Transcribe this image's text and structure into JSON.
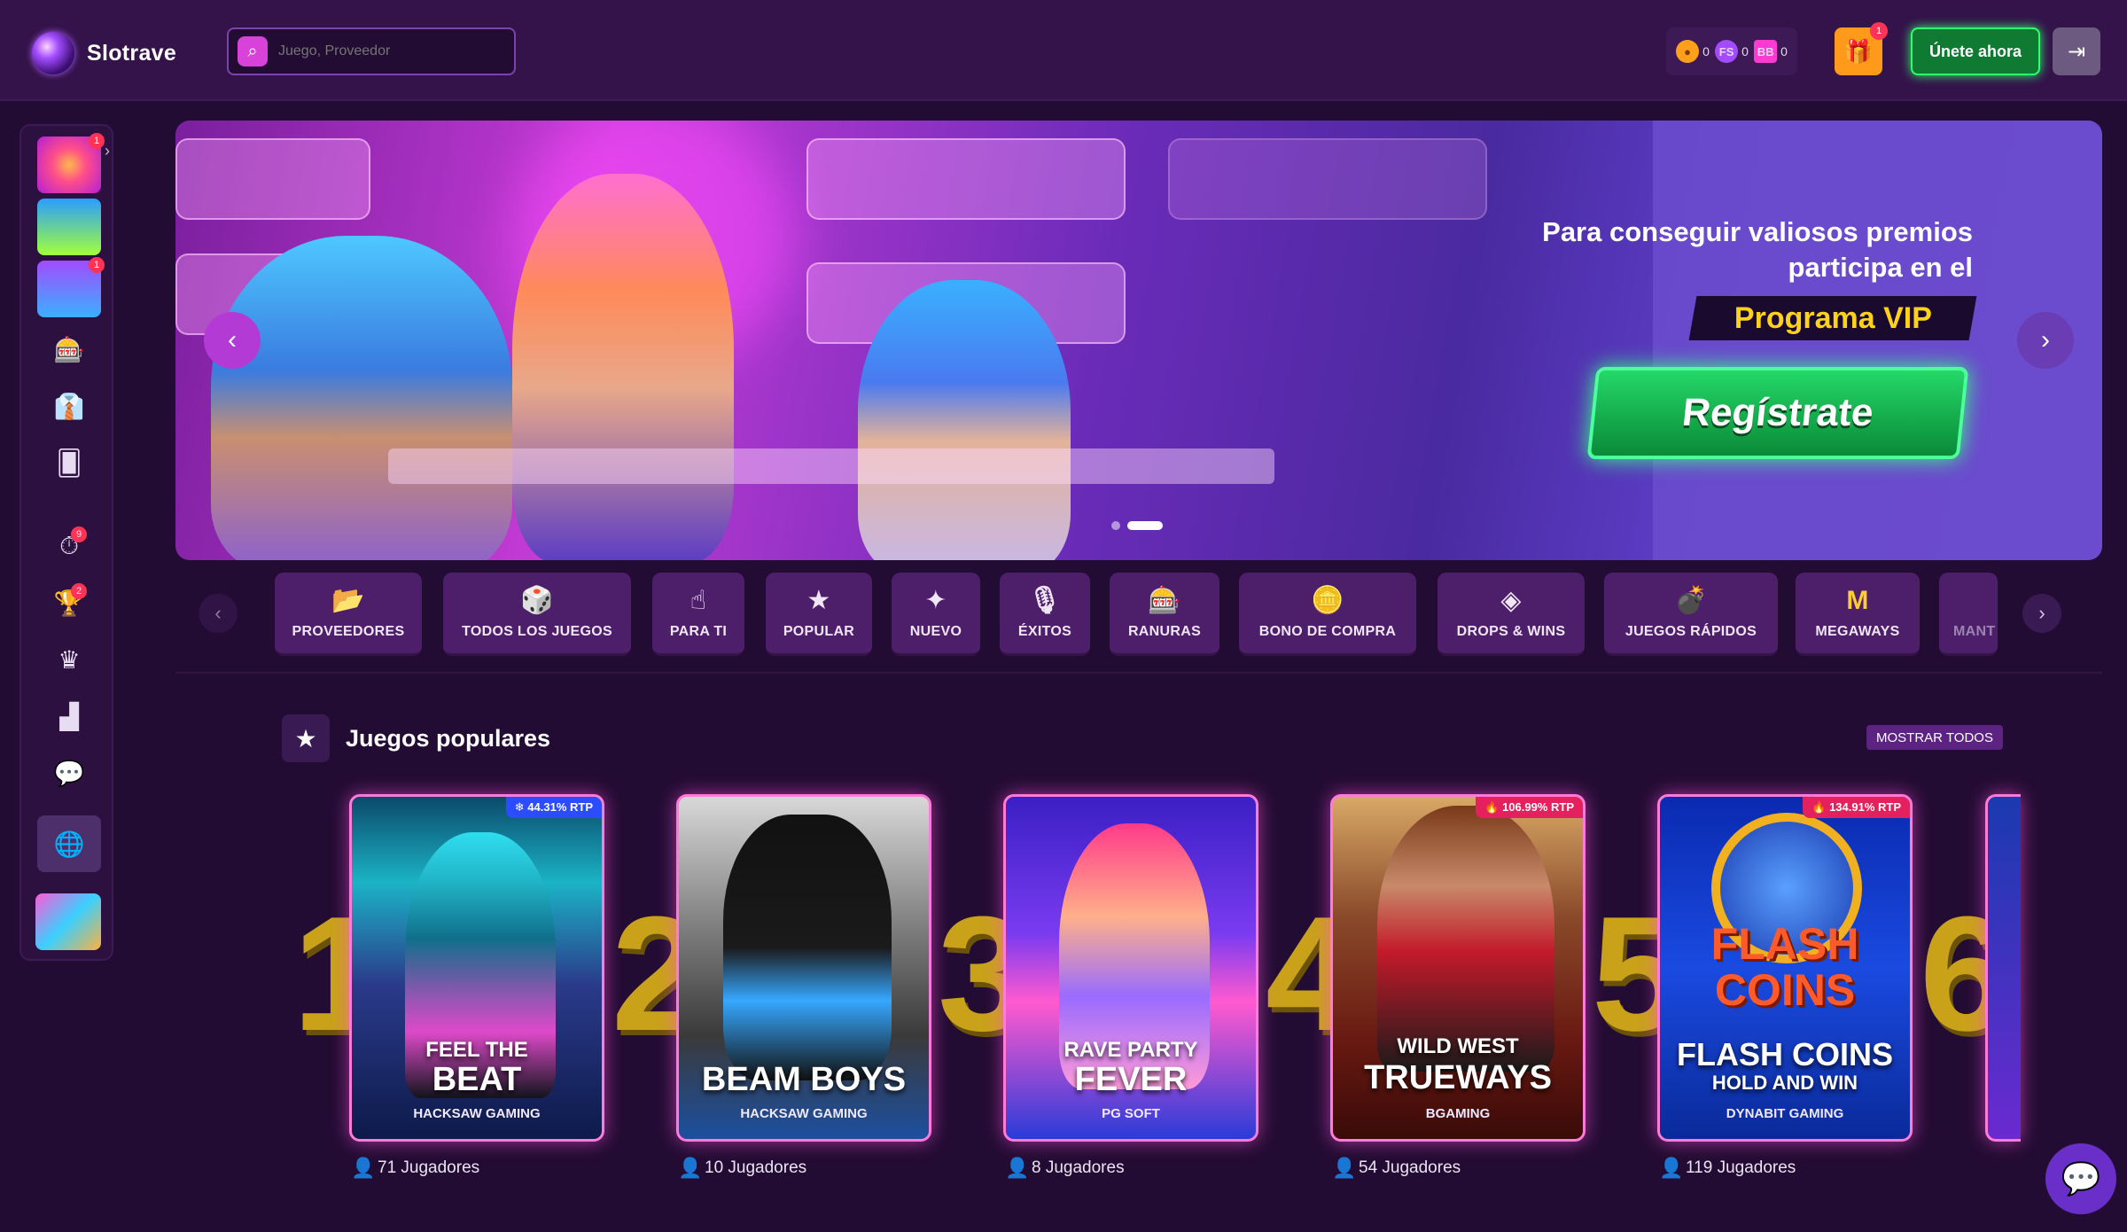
{
  "header": {
    "logo_text": "Slotrave",
    "search_placeholder": "Juego, Proveedor",
    "balances": [
      {
        "icon": "gold-coin-icon",
        "value": "0"
      },
      {
        "icon": "fs-coin-icon",
        "value": "0"
      },
      {
        "icon": "bb-coin-icon",
        "value": "0"
      }
    ],
    "gift_badge": "1",
    "join_label": "Únete ahora"
  },
  "sidebar": {
    "game_badges": [
      "1",
      "",
      "1"
    ],
    "icon_badges": {
      "timer": "9",
      "trophy": "2"
    }
  },
  "banner": {
    "text": "Para conseguir valiosos premios participa en el",
    "vip": "Programa VIP",
    "cta": "Regístrate",
    "slides": 2,
    "active_slide": 2
  },
  "categories": [
    {
      "label": "PROVEEDORES",
      "icon": "folder-icon"
    },
    {
      "label": "TODOS LOS JUEGOS",
      "icon": "dice-icon"
    },
    {
      "label": "PARA TI",
      "icon": "pointer-icon"
    },
    {
      "label": "POPULAR",
      "icon": "star-icon"
    },
    {
      "label": "NUEVO",
      "icon": "sparkle-icon"
    },
    {
      "label": "ÉXITOS",
      "icon": "microphone-icon"
    },
    {
      "label": "RANURAS",
      "icon": "slot-machine-icon"
    },
    {
      "label": "BONO DE COMPRA",
      "icon": "coin-icon"
    },
    {
      "label": "DROPS & WINS",
      "icon": "drops-wins-icon"
    },
    {
      "label": "JUEGOS RÁPIDOS",
      "icon": "bomb-icon"
    },
    {
      "label": "MEGAWAYS",
      "icon": "megaways-icon"
    },
    {
      "label": "MANT",
      "icon": "cut-off-icon"
    }
  ],
  "popular": {
    "title": "Juegos populares",
    "show_all": "MOSTRAR TODOS",
    "games": [
      {
        "rank": "1",
        "title_small": "FEEL THE",
        "title_big": "BEAT",
        "provider": "HACKSAW GAMING",
        "rtp": "❄ 44.31% RTP",
        "rtp_color": "#2c4cff",
        "players": "71 Jugadores"
      },
      {
        "rank": "2",
        "title_small": "",
        "title_big": "BEAM BOYS",
        "provider": "HACKSAW GAMING",
        "rtp": "",
        "rtp_color": "",
        "players": "10 Jugadores"
      },
      {
        "rank": "3",
        "title_small": "RAVE PARTY",
        "title_big": "FEVER",
        "provider": "PG SOFT",
        "rtp": "",
        "rtp_color": "",
        "players": "8 Jugadores"
      },
      {
        "rank": "4",
        "title_small": "WILD WEST",
        "title_big": "TRUEWAYS",
        "provider": "BGAMING",
        "rtp": "🔥 106.99% RTP",
        "rtp_color": "#e4215e",
        "players": "54 Jugadores"
      },
      {
        "rank": "5",
        "title_small": "FLASH COINS",
        "title_big": "HOLD AND WIN",
        "provider": "DYNABIT GAMING",
        "rtp": "🔥 134.91% RTP",
        "rtp_color": "#e4215e",
        "players": "119 Jugadores"
      },
      {
        "rank": "6",
        "title_small": "",
        "title_big": "",
        "provider": "",
        "rtp": "",
        "rtp_color": "",
        "players": ""
      }
    ]
  }
}
